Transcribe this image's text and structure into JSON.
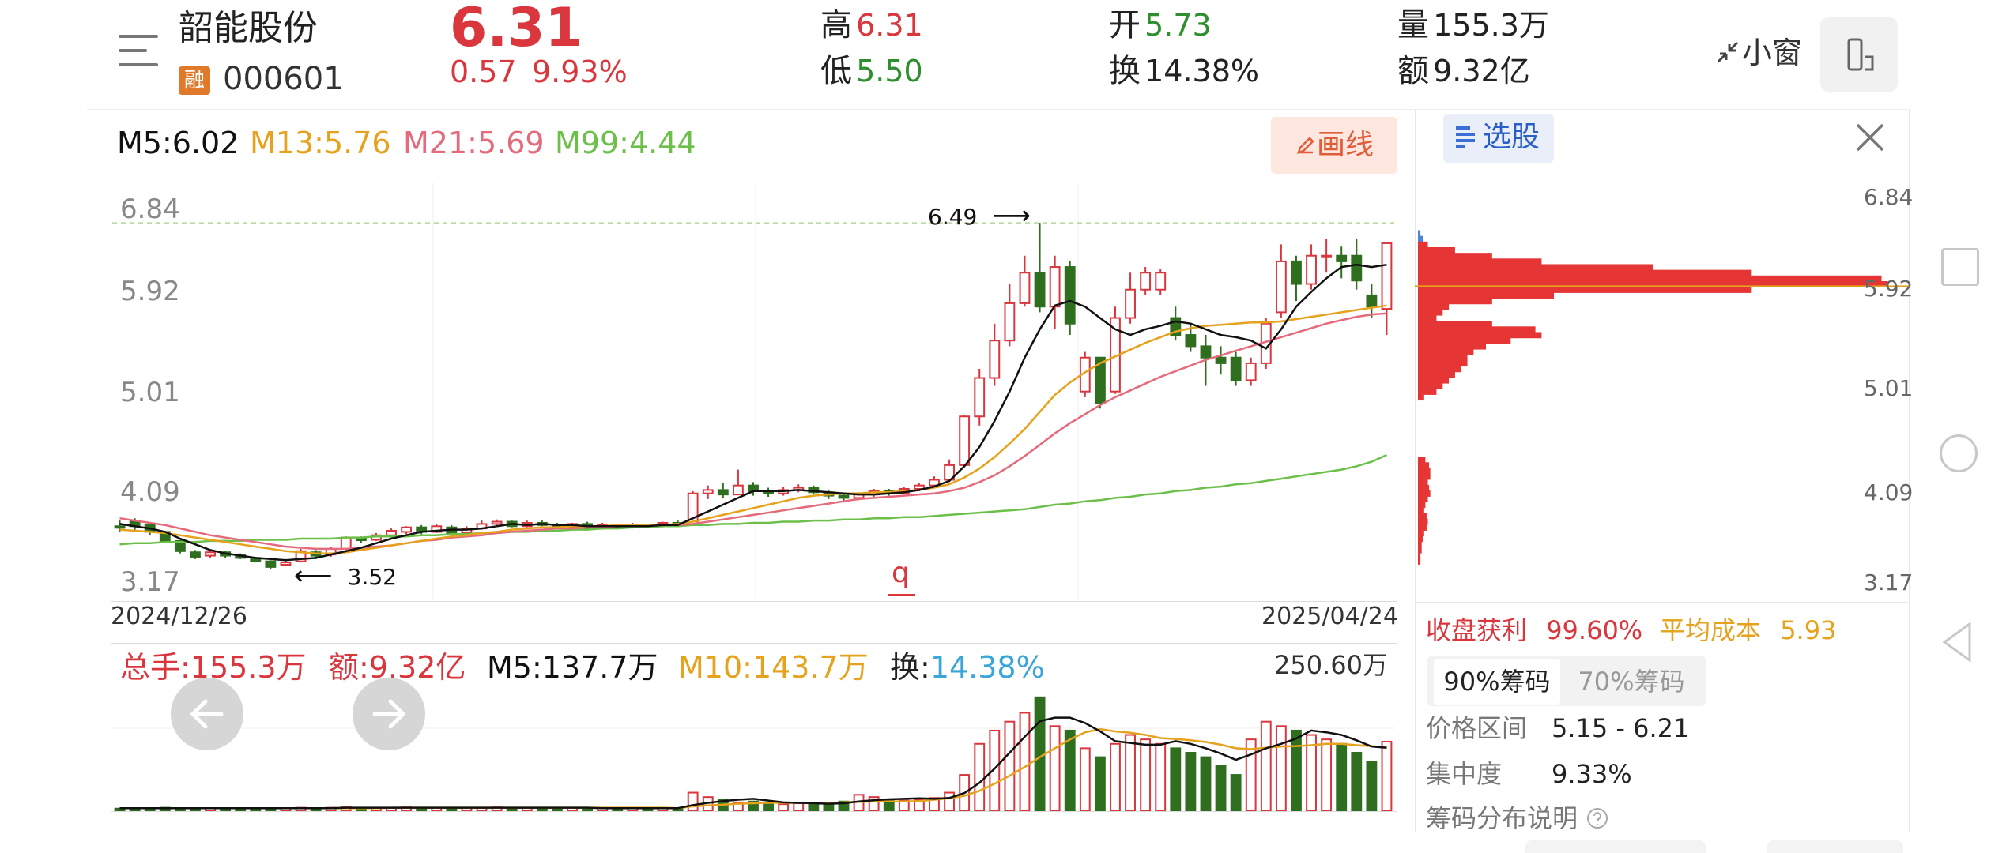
{
  "header": {
    "stock_name": "韶能股份",
    "badge": "融",
    "code": "000601",
    "price": "6.31",
    "change_abs": "0.57",
    "change_pct": "9.93%",
    "quote": {
      "high_label": "高",
      "high": "6.31",
      "low_label": "低",
      "low": "5.50",
      "open_label": "开",
      "open": "5.73",
      "turnover_label": "换",
      "turnover": "14.38%",
      "volume_label": "量",
      "volume": "155.3万",
      "amount_label": "额",
      "amount": "9.32亿"
    },
    "mini_window": "小窗"
  },
  "ma_legend": {
    "m5": "M5:6.02",
    "m13": "M13:5.76",
    "m21": "M21:5.69",
    "m99": "M99:4.44"
  },
  "draw_button": "画线",
  "kline": {
    "y_labels": [
      "6.84",
      "5.92",
      "5.01",
      "4.09",
      "3.17"
    ],
    "start_date": "2024/12/26",
    "end_date": "2025/04/24",
    "high_marker": "6.49",
    "low_marker": "3.52",
    "bottom_marker": "q"
  },
  "volume_legend": {
    "total": "总手:155.3万",
    "amount": "额:9.32亿",
    "m5": "M5:137.7万",
    "m10": "M10:143.7万",
    "turnover_label": "换:",
    "turnover": "14.38%",
    "max": "250.60万"
  },
  "right_panel": {
    "select_label": "选股",
    "y_labels": [
      "6.84",
      "5.92",
      "5.01",
      "4.09",
      "3.17"
    ],
    "profit_label": "收盘获利",
    "profit": "99.60%",
    "avg_cost_label": "平均成本",
    "avg_cost": "5.93",
    "tabs": [
      "90%筹码",
      "70%筹码"
    ],
    "range_label": "价格区间",
    "range": "5.15 - 6.21",
    "concentration_label": "集中度",
    "concentration": "9.33%",
    "explain": "筹码分布说明"
  },
  "colors": {
    "up": "#d9363e",
    "down": "#2e6e1e",
    "m5": "#111111",
    "m13": "#e6a21c",
    "m21": "#e46a7c",
    "m99": "#6cc04a",
    "turnover": "#3aa5d8"
  },
  "chart_data": {
    "type": "candlestick",
    "ohlc": [
      [
        3.81,
        3.8,
        3.86,
        3.76
      ],
      [
        3.86,
        3.81,
        3.88,
        3.77
      ],
      [
        3.82,
        3.76,
        3.84,
        3.73
      ],
      [
        3.76,
        3.68,
        3.77,
        3.66
      ],
      [
        3.68,
        3.59,
        3.69,
        3.57
      ],
      [
        3.58,
        3.54,
        3.6,
        3.52
      ],
      [
        3.55,
        3.58,
        3.6,
        3.53
      ],
      [
        3.58,
        3.55,
        3.59,
        3.53
      ],
      [
        3.56,
        3.53,
        3.57,
        3.52
      ],
      [
        3.53,
        3.5,
        3.54,
        3.49
      ],
      [
        3.5,
        3.45,
        3.51,
        3.43
      ],
      [
        3.47,
        3.49,
        3.52,
        3.46
      ],
      [
        3.5,
        3.59,
        3.61,
        3.49
      ],
      [
        3.58,
        3.55,
        3.6,
        3.52
      ],
      [
        3.56,
        3.61,
        3.63,
        3.54
      ],
      [
        3.61,
        3.71,
        3.72,
        3.6
      ],
      [
        3.7,
        3.69,
        3.72,
        3.66
      ],
      [
        3.69,
        3.73,
        3.75,
        3.68
      ],
      [
        3.73,
        3.77,
        3.79,
        3.71
      ],
      [
        3.76,
        3.8,
        3.81,
        3.74
      ],
      [
        3.8,
        3.76,
        3.82,
        3.74
      ],
      [
        3.76,
        3.81,
        3.83,
        3.75
      ],
      [
        3.8,
        3.74,
        3.82,
        3.73
      ],
      [
        3.75,
        3.79,
        3.81,
        3.73
      ],
      [
        3.79,
        3.83,
        3.86,
        3.78
      ],
      [
        3.83,
        3.85,
        3.87,
        3.81
      ],
      [
        3.85,
        3.81,
        3.86,
        3.8
      ],
      [
        3.81,
        3.84,
        3.86,
        3.8
      ],
      [
        3.84,
        3.82,
        3.86,
        3.81
      ],
      [
        3.82,
        3.8,
        3.84,
        3.79
      ],
      [
        3.8,
        3.83,
        3.84,
        3.79
      ],
      [
        3.83,
        3.79,
        3.85,
        3.78
      ],
      [
        3.79,
        3.82,
        3.84,
        3.78
      ],
      [
        3.82,
        3.8,
        3.83,
        3.79
      ],
      [
        3.8,
        3.82,
        3.84,
        3.79
      ],
      [
        3.82,
        3.81,
        3.83,
        3.8
      ],
      [
        3.81,
        3.84,
        3.85,
        3.8
      ],
      [
        3.84,
        3.82,
        3.86,
        3.81
      ],
      [
        3.82,
        4.1,
        4.12,
        3.82
      ],
      [
        4.1,
        4.13,
        4.17,
        4.05
      ],
      [
        4.13,
        4.09,
        4.19,
        4.06
      ],
      [
        4.09,
        4.17,
        4.31,
        4.12
      ],
      [
        4.17,
        4.12,
        4.2,
        4.08
      ],
      [
        4.12,
        4.1,
        4.15,
        4.07
      ],
      [
        4.1,
        4.13,
        4.16,
        4.08
      ],
      [
        4.13,
        4.15,
        4.18,
        4.11
      ],
      [
        4.15,
        4.11,
        4.17,
        4.09
      ],
      [
        4.11,
        4.08,
        4.13,
        4.05
      ],
      [
        4.08,
        4.06,
        4.1,
        4.02
      ],
      [
        4.06,
        4.09,
        4.11,
        4.04
      ],
      [
        4.09,
        4.12,
        4.14,
        4.07
      ],
      [
        4.12,
        4.1,
        4.14,
        4.08
      ],
      [
        4.1,
        4.14,
        4.16,
        4.09
      ],
      [
        4.14,
        4.17,
        4.19,
        4.12
      ],
      [
        4.17,
        4.22,
        4.25,
        4.15
      ],
      [
        4.22,
        4.35,
        4.4,
        4.2
      ],
      [
        4.35,
        4.78,
        4.79,
        4.33
      ],
      [
        4.78,
        5.12,
        5.2,
        4.7
      ],
      [
        5.12,
        5.45,
        5.6,
        5.05
      ],
      [
        5.45,
        5.78,
        5.95,
        5.4
      ],
      [
        5.78,
        6.05,
        6.2,
        5.75
      ],
      [
        6.05,
        5.75,
        6.49,
        5.7
      ],
      [
        5.75,
        6.1,
        6.2,
        5.55
      ],
      [
        6.1,
        5.6,
        6.15,
        5.5
      ],
      [
        5.0,
        5.3,
        5.35,
        4.95
      ],
      [
        5.3,
        4.9,
        5.3,
        4.85
      ],
      [
        5.0,
        5.65,
        5.75,
        4.98
      ],
      [
        5.65,
        5.9,
        6.05,
        5.6
      ],
      [
        5.9,
        6.05,
        6.1,
        5.85
      ],
      [
        5.9,
        6.05,
        6.08,
        5.85
      ],
      [
        5.65,
        5.5,
        5.75,
        5.45
      ],
      [
        5.5,
        5.4,
        5.6,
        5.35
      ],
      [
        5.4,
        5.3,
        5.5,
        5.05
      ],
      [
        5.3,
        5.25,
        5.4,
        5.15
      ],
      [
        5.3,
        5.1,
        5.35,
        5.05
      ],
      [
        5.1,
        5.25,
        5.3,
        5.05
      ],
      [
        5.25,
        5.6,
        5.65,
        5.2
      ],
      [
        5.7,
        6.15,
        6.3,
        5.65
      ],
      [
        6.15,
        5.95,
        6.2,
        5.8
      ],
      [
        5.95,
        6.2,
        6.3,
        5.9
      ],
      [
        6.2,
        6.2,
        6.35,
        6.05
      ],
      [
        6.2,
        6.15,
        6.28,
        6.0
      ],
      [
        6.2,
        5.98,
        6.35,
        5.9
      ],
      [
        5.85,
        5.75,
        5.95,
        5.65
      ],
      [
        5.73,
        6.31,
        6.31,
        5.5
      ]
    ],
    "ma5": [
      3.83,
      3.81,
      3.79,
      3.76,
      3.7,
      3.65,
      3.6,
      3.57,
      3.55,
      3.53,
      3.52,
      3.51,
      3.52,
      3.53,
      3.56,
      3.59,
      3.62,
      3.66,
      3.7,
      3.73,
      3.76,
      3.77,
      3.78,
      3.78,
      3.79,
      3.81,
      3.83,
      3.82,
      3.83,
      3.82,
      3.82,
      3.81,
      3.81,
      3.81,
      3.81,
      3.81,
      3.82,
      3.82,
      3.88,
      3.94,
      4.0,
      4.06,
      4.12,
      4.12,
      4.12,
      4.13,
      4.12,
      4.11,
      4.1,
      4.09,
      4.09,
      4.1,
      4.11,
      4.13,
      4.16,
      4.21,
      4.34,
      4.51,
      4.74,
      5.0,
      5.3,
      5.55,
      5.76,
      5.8,
      5.75,
      5.65,
      5.55,
      5.5,
      5.55,
      5.58,
      5.62,
      5.6,
      5.55,
      5.5,
      5.48,
      5.45,
      5.38,
      5.55,
      5.75,
      5.88,
      6.0,
      6.1,
      6.12,
      6.1,
      6.12
    ],
    "ma13": [
      3.78,
      3.77,
      3.76,
      3.75,
      3.73,
      3.71,
      3.69,
      3.67,
      3.65,
      3.63,
      3.61,
      3.59,
      3.58,
      3.57,
      3.57,
      3.58,
      3.6,
      3.62,
      3.64,
      3.66,
      3.68,
      3.7,
      3.72,
      3.73,
      3.75,
      3.76,
      3.78,
      3.79,
      3.8,
      3.8,
      3.81,
      3.81,
      3.81,
      3.82,
      3.82,
      3.82,
      3.82,
      3.83,
      3.85,
      3.88,
      3.91,
      3.94,
      3.97,
      4.0,
      4.03,
      4.06,
      4.08,
      4.09,
      4.1,
      4.1,
      4.11,
      4.11,
      4.12,
      4.13,
      4.15,
      4.18,
      4.24,
      4.32,
      4.42,
      4.54,
      4.67,
      4.82,
      4.97,
      5.08,
      5.17,
      5.25,
      5.31,
      5.37,
      5.43,
      5.48,
      5.53,
      5.56,
      5.58,
      5.59,
      5.6,
      5.61,
      5.61,
      5.62,
      5.64,
      5.66,
      5.68,
      5.7,
      5.72,
      5.74,
      5.76
    ],
    "ma21": [
      3.88,
      3.86,
      3.84,
      3.82,
      3.79,
      3.76,
      3.73,
      3.71,
      3.69,
      3.67,
      3.65,
      3.63,
      3.62,
      3.61,
      3.61,
      3.61,
      3.62,
      3.63,
      3.64,
      3.66,
      3.68,
      3.69,
      3.71,
      3.72,
      3.73,
      3.75,
      3.76,
      3.77,
      3.78,
      3.79,
      3.79,
      3.8,
      3.8,
      3.81,
      3.81,
      3.81,
      3.82,
      3.82,
      3.83,
      3.85,
      3.87,
      3.89,
      3.91,
      3.93,
      3.95,
      3.97,
      3.99,
      4.01,
      4.03,
      4.05,
      4.06,
      4.07,
      4.08,
      4.09,
      4.1,
      4.12,
      4.15,
      4.2,
      4.26,
      4.34,
      4.43,
      4.53,
      4.63,
      4.72,
      4.8,
      4.88,
      4.95,
      5.01,
      5.07,
      5.13,
      5.18,
      5.23,
      5.28,
      5.32,
      5.36,
      5.4,
      5.44,
      5.48,
      5.52,
      5.56,
      5.6,
      5.63,
      5.66,
      5.68,
      5.69
    ],
    "ma99": [
      3.65,
      3.66,
      3.66,
      3.67,
      3.67,
      3.67,
      3.68,
      3.68,
      3.68,
      3.69,
      3.69,
      3.69,
      3.7,
      3.7,
      3.7,
      3.71,
      3.71,
      3.72,
      3.72,
      3.72,
      3.73,
      3.73,
      3.74,
      3.74,
      3.75,
      3.75,
      3.76,
      3.76,
      3.77,
      3.77,
      3.78,
      3.78,
      3.79,
      3.79,
      3.8,
      3.8,
      3.81,
      3.81,
      3.82,
      3.82,
      3.83,
      3.83,
      3.84,
      3.84,
      3.85,
      3.85,
      3.86,
      3.86,
      3.87,
      3.87,
      3.88,
      3.88,
      3.89,
      3.89,
      3.9,
      3.91,
      3.92,
      3.93,
      3.94,
      3.95,
      3.96,
      3.98,
      4.0,
      4.01,
      4.03,
      4.04,
      4.06,
      4.07,
      4.09,
      4.1,
      4.12,
      4.13,
      4.15,
      4.16,
      4.18,
      4.19,
      4.21,
      4.23,
      4.25,
      4.27,
      4.29,
      4.31,
      4.34,
      4.38,
      4.44
    ],
    "volume": [
      4,
      5,
      4,
      6,
      5,
      4,
      5,
      4,
      4,
      5,
      4,
      5,
      6,
      5,
      6,
      7,
      5,
      6,
      6,
      7,
      5,
      6,
      5,
      6,
      6,
      7,
      5,
      6,
      5,
      5,
      6,
      5,
      5,
      5,
      6,
      5,
      6,
      5,
      40,
      30,
      25,
      18,
      20,
      15,
      14,
      16,
      15,
      14,
      20,
      35,
      30,
      25,
      22,
      24,
      28,
      40,
      80,
      150,
      180,
      200,
      220,
      255,
      190,
      180,
      140,
      120,
      150,
      170,
      160,
      150,
      140,
      130,
      120,
      100,
      80,
      160,
      200,
      190,
      180,
      170,
      160,
      150,
      130,
      110,
      155
    ],
    "vol_ma5": [
      5,
      5,
      5,
      5,
      5,
      5,
      5,
      5,
      5,
      5,
      5,
      5,
      5,
      5,
      5,
      6,
      6,
      6,
      6,
      6,
      6,
      6,
      6,
      6,
      6,
      6,
      6,
      6,
      6,
      6,
      6,
      6,
      5,
      5,
      5,
      5,
      5,
      5,
      12,
      17,
      21,
      24,
      26,
      22,
      18,
      17,
      16,
      15,
      16,
      20,
      23,
      25,
      26,
      27,
      26,
      28,
      39,
      62,
      94,
      130,
      166,
      201,
      209,
      209,
      197,
      178,
      156,
      152,
      148,
      148,
      156,
      150,
      140,
      128,
      114,
      126,
      140,
      150,
      162,
      180,
      176,
      170,
      158,
      144,
      141
    ],
    "vol_ma10": [
      5,
      5,
      5,
      5,
      5,
      5,
      5,
      5,
      5,
      5,
      5,
      5,
      5,
      5,
      5,
      5,
      5,
      5,
      6,
      6,
      6,
      6,
      6,
      6,
      6,
      6,
      6,
      6,
      6,
      6,
      6,
      6,
      6,
      6,
      6,
      6,
      6,
      5,
      9,
      11,
      13,
      15,
      16,
      17,
      17,
      17,
      16,
      16,
      18,
      19,
      20,
      20,
      20,
      21,
      24,
      27,
      33,
      44,
      60,
      78,
      98,
      120,
      140,
      160,
      176,
      183,
      178,
      175,
      170,
      163,
      161,
      158,
      154,
      148,
      140,
      138,
      141,
      144,
      145,
      147,
      150,
      150,
      147,
      145,
      142
    ],
    "chip_distribution": [
      [
        6.4,
        2
      ],
      [
        6.35,
        4
      ],
      [
        6.3,
        8
      ],
      [
        6.25,
        30
      ],
      [
        6.2,
        60
      ],
      [
        6.15,
        100
      ],
      [
        6.1,
        190
      ],
      [
        6.05,
        270
      ],
      [
        6.0,
        375
      ],
      [
        5.95,
        380
      ],
      [
        5.9,
        270
      ],
      [
        5.85,
        110
      ],
      [
        5.8,
        60
      ],
      [
        5.75,
        25
      ],
      [
        5.7,
        20
      ],
      [
        5.65,
        15
      ],
      [
        5.6,
        60
      ],
      [
        5.55,
        95
      ],
      [
        5.5,
        100
      ],
      [
        5.45,
        75
      ],
      [
        5.4,
        55
      ],
      [
        5.35,
        45
      ],
      [
        5.3,
        40
      ],
      [
        5.25,
        40
      ],
      [
        5.2,
        35
      ],
      [
        5.15,
        30
      ],
      [
        5.1,
        25
      ],
      [
        5.05,
        20
      ],
      [
        5.0,
        15
      ],
      [
        4.95,
        5
      ],
      [
        4.4,
        6
      ],
      [
        4.35,
        9
      ],
      [
        4.3,
        10
      ],
      [
        4.25,
        10
      ],
      [
        4.2,
        8
      ],
      [
        4.15,
        9
      ],
      [
        4.1,
        10
      ],
      [
        4.05,
        8
      ],
      [
        4.0,
        6
      ],
      [
        3.95,
        5
      ],
      [
        3.9,
        7
      ],
      [
        3.85,
        8
      ],
      [
        3.8,
        7
      ],
      [
        3.75,
        5
      ],
      [
        3.7,
        4
      ],
      [
        3.65,
        3
      ],
      [
        3.6,
        3
      ],
      [
        3.55,
        2
      ],
      [
        3.5,
        2
      ]
    ],
    "ylim": [
      3.17,
      6.84
    ]
  }
}
